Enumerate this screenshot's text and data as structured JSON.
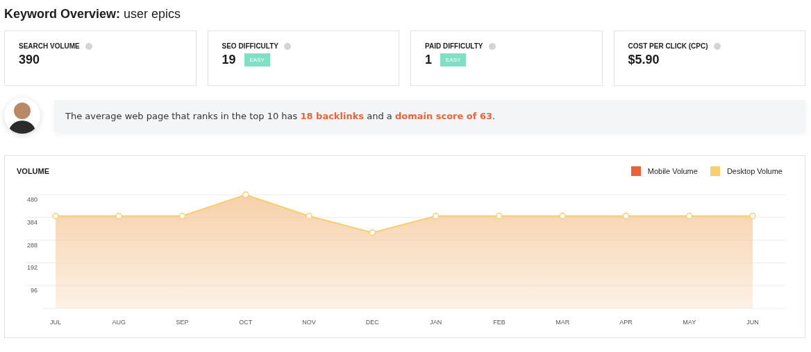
{
  "page_title": {
    "label": "Keyword Overview:",
    "keyword": "user epics"
  },
  "metrics": [
    {
      "label": "SEARCH VOLUME",
      "value": "390"
    },
    {
      "label": "SEO DIFFICULTY",
      "value": "19",
      "badge": "EASY"
    },
    {
      "label": "PAID DIFFICULTY",
      "value": "1",
      "badge": "EASY"
    },
    {
      "label": "COST PER CLICK (CPC)",
      "value": "$5.90"
    }
  ],
  "insight": {
    "text": "The average web page that ranks in the top 10 has **18 backlinks** and a **domain score of 63**."
  },
  "volume_chart": {
    "title": "VOLUME",
    "chart_data": {
      "type": "area",
      "categories": [
        "JUL",
        "AUG",
        "SEP",
        "OCT",
        "NOV",
        "DEC",
        "JAN",
        "FEB",
        "MAR",
        "APR",
        "MAY",
        "JUN"
      ],
      "series": [
        {
          "name": "Mobile Volume",
          "color": "#e8623a",
          "values": [
            null,
            null,
            null,
            null,
            null,
            null,
            null,
            null,
            null,
            null,
            null,
            null
          ]
        },
        {
          "name": "Desktop Volume",
          "color": "#f8cf6e",
          "values": [
            390,
            390,
            390,
            480,
            390,
            320,
            390,
            390,
            390,
            390,
            390,
            390
          ]
        }
      ],
      "grid": true,
      "ylim": [
        0,
        480
      ],
      "yticks": [
        96,
        192,
        288,
        384,
        480
      ]
    }
  }
}
